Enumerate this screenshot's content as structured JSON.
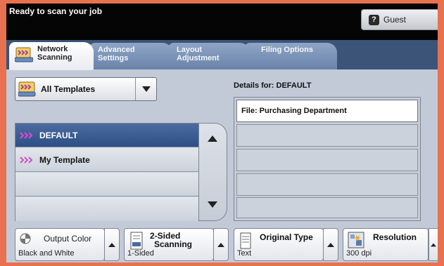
{
  "status": {
    "message": "Ready to scan your job",
    "user_label": "Guest",
    "user_icon": "?"
  },
  "tabs": [
    {
      "label_line1": "Network",
      "label_line2": "Scanning",
      "active": true
    },
    {
      "label_line1": "Advanced",
      "label_line2": "Settings",
      "active": false
    },
    {
      "label_line1": "Layout",
      "label_line2": "Adjustment",
      "active": false
    },
    {
      "label_line1": "Filing Options",
      "label_line2": "",
      "active": false
    }
  ],
  "templates": {
    "dropdown_label": "All Templates",
    "items": [
      "DEFAULT",
      "My Template"
    ]
  },
  "details": {
    "heading": "Details for: DEFAULT",
    "rows": [
      "File: Purchasing Department"
    ]
  },
  "features": [
    {
      "title": "Output Color",
      "value": "Black and White"
    },
    {
      "title": "2-Sided Scanning",
      "title_line1": "2-Sided",
      "title_line2": "Scanning",
      "value": "1-Sided"
    },
    {
      "title": "Original Type",
      "value": "Text"
    },
    {
      "title": "Resolution",
      "value": "300 dpi"
    }
  ],
  "colors": {
    "accent": "#2d4f86",
    "frame": "#e8724f",
    "tab_bar": "#3b5478"
  }
}
